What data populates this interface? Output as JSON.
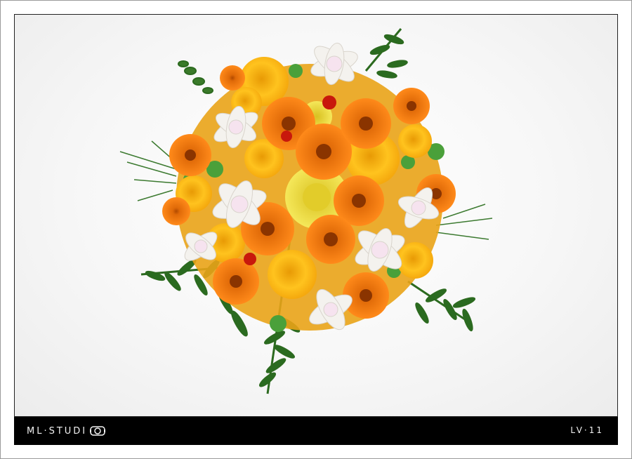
{
  "footer": {
    "brand": "ML·STUDI",
    "brand_icon": "camera-lens-icon",
    "code": "LV·11"
  },
  "colors": {
    "frame": "#9a9a9a",
    "bar": "#000000",
    "orange_gerbera": "#f07a12",
    "yellow_rose": "#f7b812",
    "white_orchid": "#f4f2ee",
    "fern_green": "#2f6a22"
  }
}
